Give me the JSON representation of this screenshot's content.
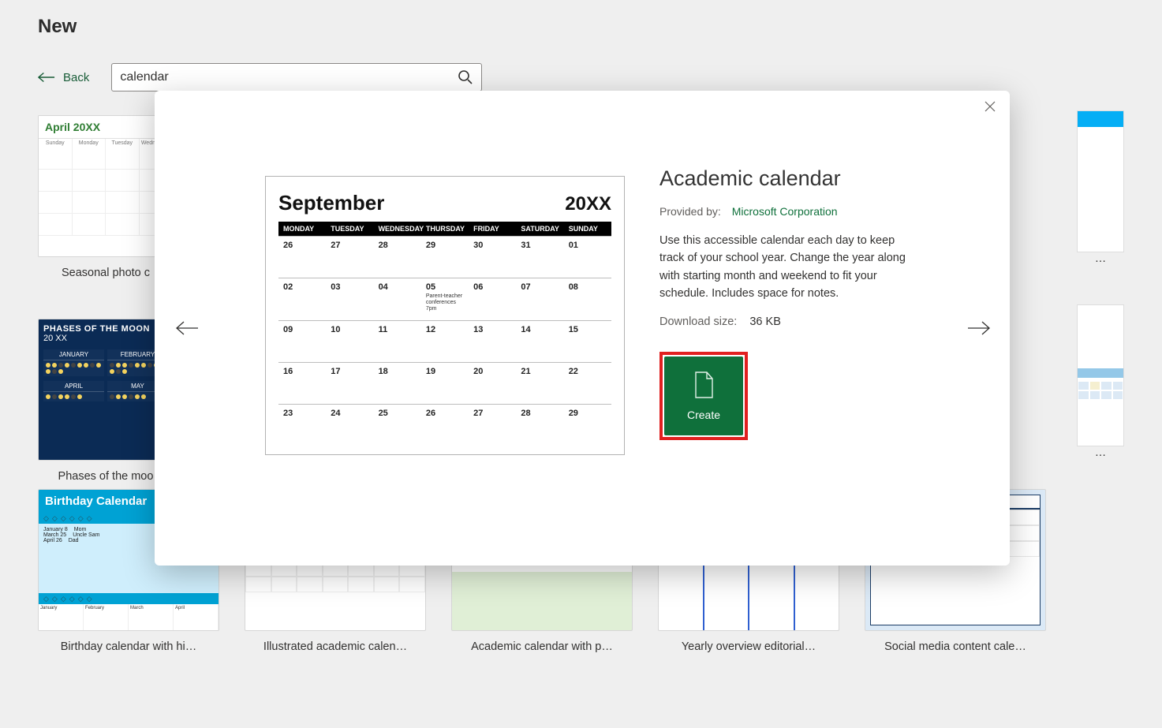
{
  "page": {
    "title": "New"
  },
  "nav": {
    "back": "Back"
  },
  "search": {
    "value": "calendar"
  },
  "cards_row1": [
    {
      "label": "Seasonal photo c"
    },
    {
      "label": "Phases of the moo"
    }
  ],
  "cards_row2": [
    {
      "label": "Birthday calendar with hi…"
    },
    {
      "label": "Illustrated academic calen…"
    },
    {
      "label": "Academic calendar with p…"
    },
    {
      "label": "Yearly overview editorial…"
    },
    {
      "label": "Social media content cale…"
    }
  ],
  "right_label": "…",
  "modal": {
    "title": "Academic calendar",
    "provided_by_label": "Provided by:",
    "provided_by_value": "Microsoft Corporation",
    "description": "Use this accessible calendar each day to keep track of your school year. Change the year along with starting month and weekend to fit your schedule. Includes space for notes.",
    "download_label": "Download size:",
    "download_value": "36 KB",
    "create_label": "Create"
  },
  "preview": {
    "month": "September",
    "year": "20XX",
    "dow": [
      "MONDAY",
      "TUESDAY",
      "WEDNESDAY",
      "THURSDAY",
      "FRIDAY",
      "SATURDAY",
      "SUNDAY"
    ],
    "cells": [
      [
        "26",
        "27",
        "28",
        "29",
        "30",
        "31",
        "01"
      ],
      [
        "02",
        "03",
        "04",
        "05",
        "06",
        "07",
        "08"
      ],
      [
        "09",
        "10",
        "11",
        "12",
        "13",
        "14",
        "15"
      ],
      [
        "16",
        "17",
        "18",
        "19",
        "20",
        "21",
        "22"
      ],
      [
        "23",
        "24",
        "25",
        "26",
        "27",
        "28",
        "29"
      ]
    ],
    "note_cell": {
      "row": 1,
      "col": 3,
      "text": "Parent-teacher conferences 7pm"
    }
  },
  "thumb_seasonal": {
    "title": "April 20XX",
    "dow": [
      "Sunday",
      "Monday",
      "Tuesday",
      "Wednesday"
    ]
  },
  "thumb_moon": {
    "title": "PHASES OF THE MOON",
    "year": "20 XX",
    "m1": "JANUARY",
    "m2": "FEBRUARY",
    "m3": "APRIL",
    "m4": "MAY"
  },
  "thumb_bday": {
    "title": "Birthday Calendar"
  }
}
